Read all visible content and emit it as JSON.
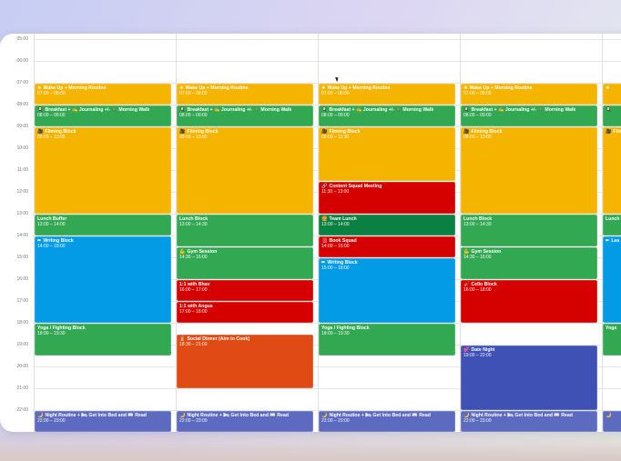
{
  "times": [
    "05:00",
    "06:00",
    "07:00",
    "08:00",
    "09:00",
    "10:00",
    "11:00",
    "12:00",
    "13:00",
    "14:00",
    "15:00",
    "16:00",
    "17:00",
    "18:00",
    "19:00",
    "20:00",
    "21:00",
    "22:00"
  ],
  "colors": {
    "yellow": "#f4b400",
    "green": "#33a853",
    "darkgreen": "#0b8043",
    "red": "#d50000",
    "blue": "#039be5",
    "orange": "#e04a14",
    "indigo": "#3f51b5",
    "lavender": "#5c6bc0"
  },
  "days": [
    {
      "events": [
        {
          "icon": "☀",
          "title": "Wake Up + Morning Routine",
          "time": "07:00 – 08:00",
          "start": 7,
          "end": 8,
          "color": "yellow"
        },
        {
          "icon": "🍳",
          "title": "Breakfast + ✍ Journaling +/- 🚶 Morning Walk",
          "time": "08:00 – 09:00",
          "start": 8,
          "end": 9,
          "color": "green"
        },
        {
          "icon": "🎥",
          "title": "Filming Block",
          "time": "09:00 – 13:00",
          "start": 9,
          "end": 13,
          "color": "yellow"
        },
        {
          "icon": "",
          "title": "Lunch Buffer",
          "time": "13:00 – 14:00",
          "start": 13,
          "end": 14,
          "color": "green"
        },
        {
          "icon": "✏",
          "title": "Writing Block",
          "time": "14:00 – 18:00",
          "start": 14,
          "end": 18,
          "color": "blue"
        },
        {
          "icon": "",
          "title": "Yoga / Fighting Block",
          "time": "18:00 – 19:30",
          "start": 18,
          "end": 19.5,
          "color": "green"
        },
        {
          "icon": "🌙",
          "title": "Night Routine + 🛏 Get Into Bed and 📖 Read",
          "time": "22:00 – 23:00",
          "start": 22,
          "end": 23,
          "color": "lavender"
        }
      ]
    },
    {
      "events": [
        {
          "icon": "☀",
          "title": "Wake Up + Morning Routine",
          "time": "07:00 – 08:00",
          "start": 7,
          "end": 8,
          "color": "yellow"
        },
        {
          "icon": "🍳",
          "title": "Breakfast + ✍ Journaling +/- 🚶 Morning Walk",
          "time": "08:00 – 09:00",
          "start": 8,
          "end": 9,
          "color": "green"
        },
        {
          "icon": "🎥",
          "title": "Filming Block",
          "time": "09:00 – 13:00",
          "start": 9,
          "end": 13,
          "color": "yellow"
        },
        {
          "icon": "",
          "title": "Lunch Block",
          "time": "13:00 – 14:30",
          "start": 13,
          "end": 14.5,
          "color": "green"
        },
        {
          "icon": "💪",
          "title": "Gym Session",
          "time": "14:30 – 16:00",
          "start": 14.5,
          "end": 16,
          "color": "green"
        },
        {
          "icon": "",
          "title": "1:1 with Bhav",
          "time": "16:00 – 17:00",
          "start": 16,
          "end": 17,
          "color": "red"
        },
        {
          "icon": "",
          "title": "1:1 with Angus",
          "time": "17:00 – 18:00",
          "start": 17,
          "end": 18,
          "color": "red"
        },
        {
          "icon": "⏳",
          "title": "Social Dinner (Aim to Cook)",
          "time": "18:30 – 21:00",
          "start": 18.5,
          "end": 21,
          "color": "orange"
        },
        {
          "icon": "🌙",
          "title": "Night Routine + 🛏 Get Into Bed and 📖 Read",
          "time": "22:00 – 23:00",
          "start": 22,
          "end": 23,
          "color": "lavender"
        }
      ]
    },
    {
      "events": [
        {
          "icon": "☀",
          "title": "Wake Up + Morning Routine",
          "time": "07:00 – 08:00",
          "start": 7,
          "end": 8,
          "color": "yellow"
        },
        {
          "icon": "🍳",
          "title": "Breakfast + ✍ Journaling +/- 🚶 Morning Walk",
          "time": "08:00 – 09:00",
          "start": 8,
          "end": 9,
          "color": "green"
        },
        {
          "icon": "🎥",
          "title": "Filming Block",
          "time": "09:00 – 11:30",
          "start": 9,
          "end": 11.5,
          "color": "yellow"
        },
        {
          "icon": "🔗",
          "title": "Content Squad Meeting",
          "time": "11:30 – 13:00",
          "start": 11.5,
          "end": 13,
          "color": "red"
        },
        {
          "icon": "🍔",
          "title": "Team Lunch",
          "time": "13:00 – 14:00",
          "start": 13,
          "end": 14,
          "color": "darkgreen"
        },
        {
          "icon": "📕",
          "title": "Book Squad",
          "time": "14:00 – 15:00",
          "start": 14,
          "end": 15,
          "color": "red"
        },
        {
          "icon": "✏",
          "title": "Writing Block",
          "time": "15:00 – 18:00",
          "start": 15,
          "end": 18,
          "color": "blue"
        },
        {
          "icon": "",
          "title": "Yoga / Fighting Block",
          "time": "18:00 – 19:30",
          "start": 18,
          "end": 19.5,
          "color": "green"
        },
        {
          "icon": "🌙",
          "title": "Night Routine + 🛏 Get Into Bed and 📖 Read",
          "time": "22:00 – 23:00",
          "start": 22,
          "end": 23,
          "color": "lavender"
        }
      ]
    },
    {
      "events": [
        {
          "icon": "☀",
          "title": "Wake Up + Morning Routine",
          "time": "07:00 – 08:00",
          "start": 7,
          "end": 8,
          "color": "yellow"
        },
        {
          "icon": "🍳",
          "title": "Breakfast + ✍ Journaling +/- 🚶 Morning Walk",
          "time": "08:00 – 09:00",
          "start": 8,
          "end": 9,
          "color": "green"
        },
        {
          "icon": "🎥",
          "title": "Filming Block",
          "time": "09:00 – 13:00",
          "start": 9,
          "end": 13,
          "color": "yellow"
        },
        {
          "icon": "",
          "title": "Lunch Block",
          "time": "13:00 – 14:30",
          "start": 13,
          "end": 14.5,
          "color": "green"
        },
        {
          "icon": "💪",
          "title": "Gym Session",
          "time": "14:30 – 16:00",
          "start": 14.5,
          "end": 16,
          "color": "green"
        },
        {
          "icon": "🎻",
          "title": "Cello Block",
          "time": "16:00 – 18:00",
          "start": 16,
          "end": 18,
          "color": "red"
        },
        {
          "icon": "💕",
          "title": "Date Night",
          "time": "19:00 – 22:00",
          "start": 19,
          "end": 22,
          "color": "indigo"
        },
        {
          "icon": "🌙",
          "title": "Night Routine + 🛏 Get Into Bed and 📖 Read",
          "time": "22:00 – 23:00",
          "start": 22,
          "end": 23,
          "color": "lavender"
        }
      ]
    },
    {
      "events": [
        {
          "icon": "☀",
          "title": "",
          "time": "",
          "start": 7,
          "end": 8,
          "color": "yellow"
        },
        {
          "icon": "🍳",
          "title": "",
          "time": "",
          "start": 8,
          "end": 9,
          "color": "green"
        },
        {
          "icon": "🎥",
          "title": "Film",
          "time": "",
          "start": 9,
          "end": 13,
          "color": "yellow"
        },
        {
          "icon": "",
          "title": "Lunch",
          "time": "",
          "start": 13,
          "end": 14,
          "color": "green"
        },
        {
          "icon": "✏",
          "title": "Lea",
          "time": "",
          "start": 14,
          "end": 18,
          "color": "blue"
        },
        {
          "icon": "",
          "title": "Yoga",
          "time": "",
          "start": 18,
          "end": 19.5,
          "color": "green"
        },
        {
          "icon": "🌙",
          "title": "",
          "time": "",
          "start": 22,
          "end": 23,
          "color": "lavender"
        }
      ]
    }
  ]
}
